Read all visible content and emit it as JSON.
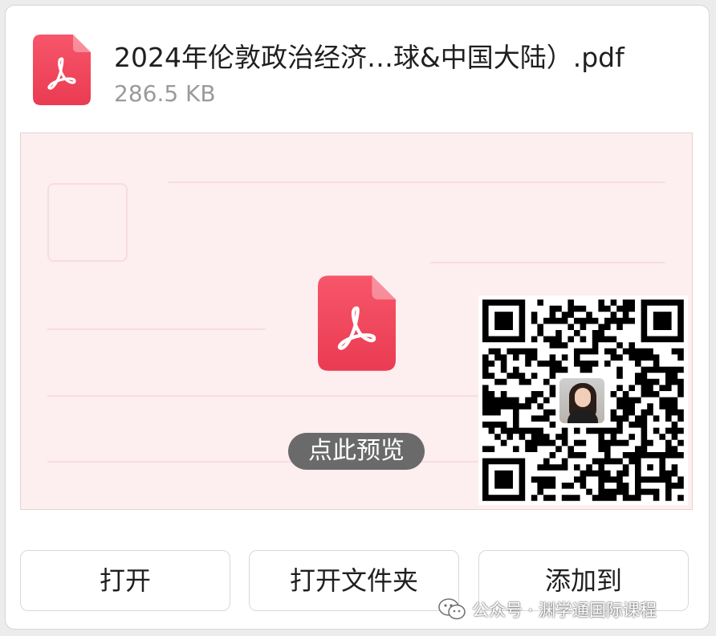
{
  "file": {
    "name": "2024年伦敦政治经济…球&中国大陆）.pdf",
    "size": "286.5 KB",
    "icon": "pdf-file-icon"
  },
  "preview": {
    "label": "点此预览",
    "icon": "pdf-file-icon",
    "overlay": "qr-code"
  },
  "buttons": {
    "open": "打开",
    "open_folder": "打开文件夹",
    "add_to": "添加到"
  },
  "watermark": {
    "text": "公众号 · 渊学通国际课程",
    "icon": "wechat-icon"
  },
  "colors": {
    "pdf_red": "#f24a5e",
    "preview_bg": "#fdeef0"
  }
}
